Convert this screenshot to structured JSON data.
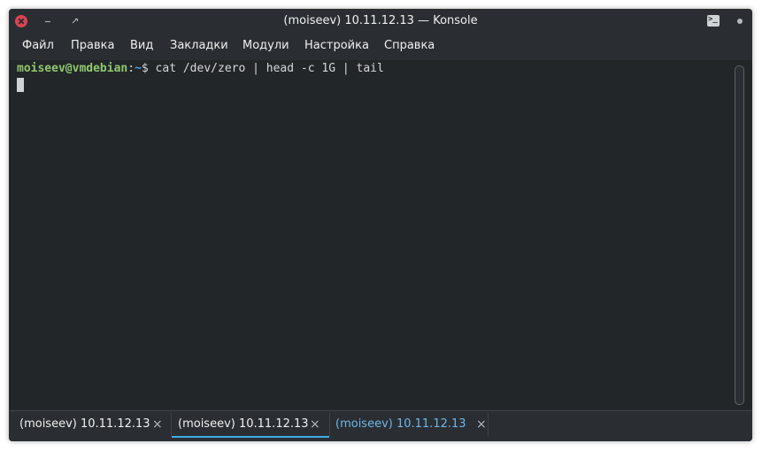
{
  "window": {
    "title": "(moiseev) 10.11.12.13 — Konsole"
  },
  "menubar": {
    "items": [
      "Файл",
      "Правка",
      "Вид",
      "Закладки",
      "Модули",
      "Настройка",
      "Справка"
    ]
  },
  "terminal": {
    "prompt_user_host": "moiseev@vmdebian",
    "prompt_colon": ":",
    "prompt_path": "~",
    "prompt_symbol": "$ ",
    "command": "cat /dev/zero | head -c 1G | tail"
  },
  "tabs": [
    {
      "label": "(moiseev) 10.11.12.13",
      "close": "×",
      "active": false
    },
    {
      "label": "(moiseev) 10.11.12.13",
      "close": "×",
      "active": true
    },
    {
      "label": "(moiseev) 10.11.12.13",
      "close": "×",
      "active": false
    }
  ],
  "colors": {
    "window_bg": "#2a2e32",
    "terminal_bg": "#232629",
    "prompt_user": "#8ec86f",
    "prompt_path": "#4ca0e0",
    "accent": "#3daee9",
    "close_button": "#da4453"
  },
  "icons": {
    "close": "close-icon",
    "minimize": "minimize-icon",
    "maximize": "maximize-icon",
    "terminal": "terminal-icon",
    "keep_above": "dot-icon"
  }
}
